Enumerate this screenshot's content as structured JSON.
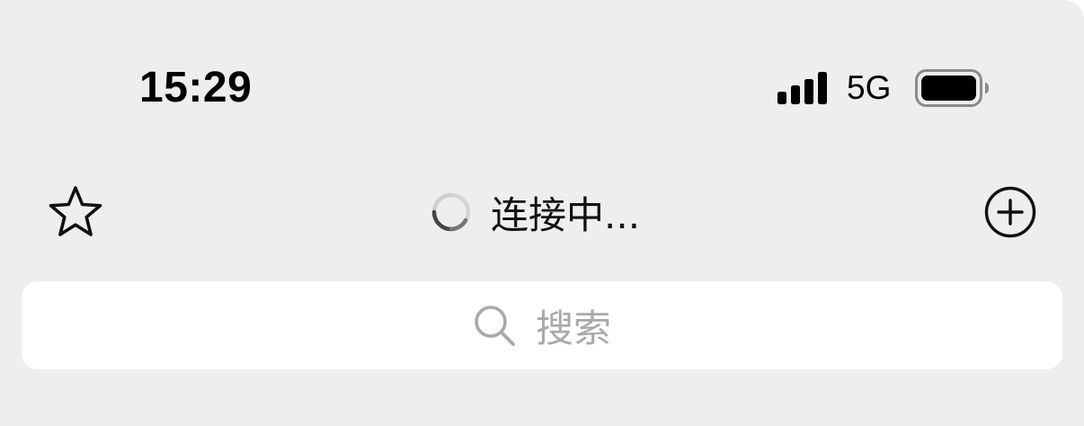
{
  "status_bar": {
    "time": "15:29",
    "network": "5G",
    "signal_bars": 4,
    "battery_icon": "battery-icon",
    "signal_icon": "signal-icon"
  },
  "nav_bar": {
    "title": "连接中...",
    "left_icon": "star-icon",
    "right_icon": "plus-circle-icon",
    "loading_icon": "spinner-icon"
  },
  "search": {
    "placeholder": "搜索",
    "icon": "search-icon"
  },
  "colors": {
    "background": "#eeeeee",
    "search_background": "#ffffff",
    "placeholder": "#a9a9a9",
    "text": "#111111"
  }
}
